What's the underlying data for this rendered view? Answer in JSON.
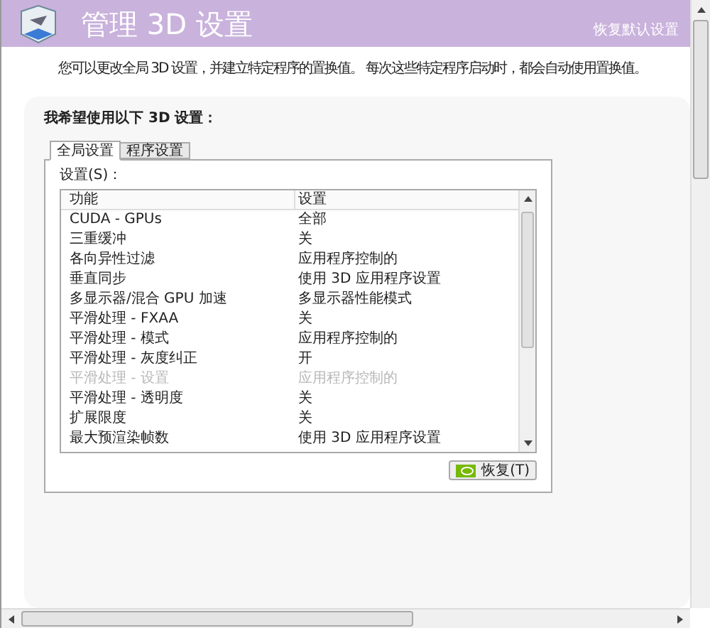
{
  "header": {
    "title": "管理 3D 设置",
    "restore_defaults_link": "恢复默认设置"
  },
  "description": "您可以更改全局 3D 设置，并建立特定程序的置换值。 每次这些特定程序启动时，都会自动使用置换值。",
  "section_heading": "我希望使用以下 3D 设置：",
  "tabs": [
    {
      "label": "全局设置",
      "selected": true
    },
    {
      "label": "程序设置",
      "selected": false
    }
  ],
  "settings_label": "设置(S)：",
  "table": {
    "columns": [
      "功能",
      "设置"
    ],
    "rows": [
      {
        "feature": "CUDA - GPUs",
        "value": "全部",
        "disabled": false
      },
      {
        "feature": "三重缓冲",
        "value": "关",
        "disabled": false
      },
      {
        "feature": "各向异性过滤",
        "value": "应用程序控制的",
        "disabled": false
      },
      {
        "feature": "垂直同步",
        "value": "使用 3D 应用程序设置",
        "disabled": false
      },
      {
        "feature": "多显示器/混合 GPU 加速",
        "value": "多显示器性能模式",
        "disabled": false
      },
      {
        "feature": "平滑处理 - FXAA",
        "value": "关",
        "disabled": false
      },
      {
        "feature": "平滑处理 - 模式",
        "value": "应用程序控制的",
        "disabled": false
      },
      {
        "feature": "平滑处理 - 灰度纠正",
        "value": "开",
        "disabled": false
      },
      {
        "feature": "平滑处理 - 设置",
        "value": "应用程序控制的",
        "disabled": true
      },
      {
        "feature": "平滑处理 - 透明度",
        "value": "关",
        "disabled": false
      },
      {
        "feature": "扩展限度",
        "value": "关",
        "disabled": false
      },
      {
        "feature": "最大预渲染帧数",
        "value": "使用 3D 应用程序设置",
        "disabled": false
      }
    ]
  },
  "restore_button": "恢复(T)"
}
